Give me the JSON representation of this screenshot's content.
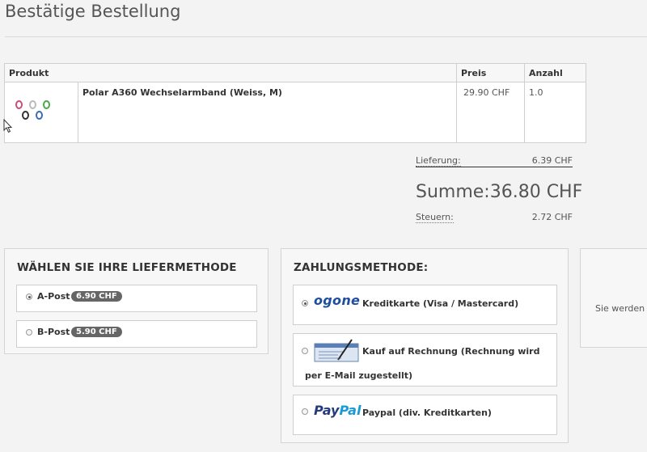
{
  "page_title": "Bestätige Bestellung",
  "cart": {
    "headers": {
      "product": "Produkt",
      "price": "Preis",
      "qty": "Anzahl"
    },
    "items": [
      {
        "name": "Polar A360 Wechselarmband (Weiss, M)",
        "price": "29.90 CHF",
        "qty": "1.0"
      }
    ]
  },
  "summary": {
    "delivery_label": "Lieferung:",
    "delivery_value": "6.39 CHF",
    "total_label": "Summe:",
    "total_value": "36.80 CHF",
    "tax_label": "Steuern:",
    "tax_value": "2.72 CHF"
  },
  "shipping": {
    "title": "WÄHLEN SIE IHRE LIEFERMETHODE",
    "options": [
      {
        "label": "A-Post",
        "price": "6.90 CHF",
        "selected": true
      },
      {
        "label": "B-Post",
        "price": "5.90 CHF",
        "selected": false
      }
    ]
  },
  "payment": {
    "title": "ZAHLUNGSMETHODE:",
    "options": [
      {
        "logo": "ogone",
        "label": "Kreditkarte (Visa / Mastercard)",
        "selected": true
      },
      {
        "logo": "cheque-icon",
        "label_line1": "Kauf auf Rechnung (Rechnung wird",
        "label_line2": "per E-Mail zugestellt)",
        "selected": false
      },
      {
        "logo": "PayPal",
        "label": "Paypal (div. Kreditkarten)",
        "selected": false
      }
    ]
  },
  "third_panel": {
    "text": "Sie werden"
  },
  "colors": {
    "ogone": "#1f4e9c",
    "paypal_dark": "#253b80",
    "paypal_light": "#179bd7",
    "badge": "#666666"
  }
}
